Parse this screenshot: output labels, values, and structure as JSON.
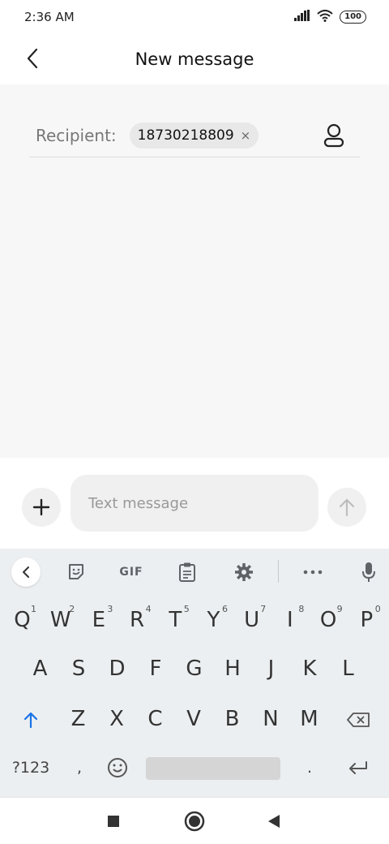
{
  "status_bar": {
    "time": "2:36 AM",
    "battery": "100"
  },
  "header": {
    "title": "New message",
    "back_icon": "chevron-left-icon"
  },
  "recipient": {
    "label": "Recipient:",
    "chip_value": "18730218809",
    "chip_remove": "×",
    "contact_icon": "person-icon"
  },
  "compose": {
    "placeholder": "Text message",
    "add_icon": "plus-icon",
    "send_icon": "arrow-up-icon"
  },
  "keyboard": {
    "toolbar": {
      "gif_label": "GIF"
    },
    "row1": [
      {
        "key": "Q",
        "hint": "1"
      },
      {
        "key": "W",
        "hint": "2"
      },
      {
        "key": "E",
        "hint": "3"
      },
      {
        "key": "R",
        "hint": "4"
      },
      {
        "key": "T",
        "hint": "5"
      },
      {
        "key": "Y",
        "hint": "6"
      },
      {
        "key": "U",
        "hint": "7"
      },
      {
        "key": "I",
        "hint": "8"
      },
      {
        "key": "O",
        "hint": "9"
      },
      {
        "key": "P",
        "hint": "0"
      }
    ],
    "row2": [
      "A",
      "S",
      "D",
      "F",
      "G",
      "H",
      "J",
      "K",
      "L"
    ],
    "row3": [
      "Z",
      "X",
      "C",
      "V",
      "B",
      "N",
      "M"
    ],
    "numbers_key": "?123",
    "comma_key": ",",
    "period_key": "."
  },
  "colors": {
    "shift_active": "#1a73e8",
    "send_disabled": "#bdbdbd"
  }
}
